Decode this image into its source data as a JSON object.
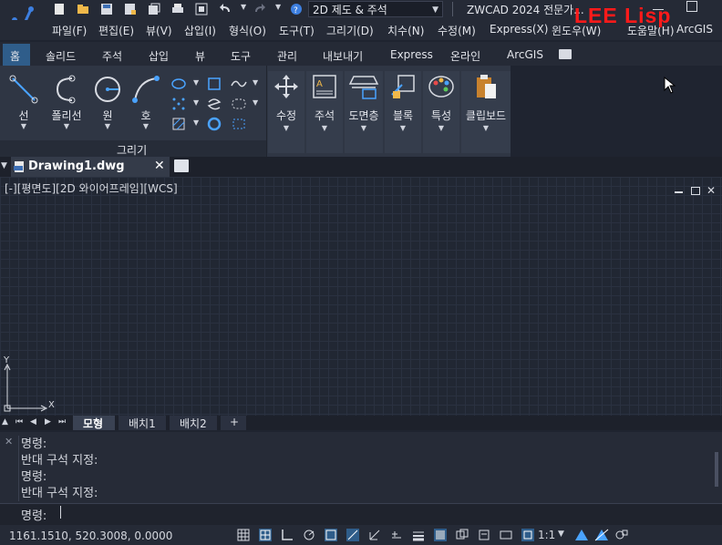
{
  "titlebar": {
    "workspace": "2D 제도 & 주석",
    "app_title": "ZWCAD 2024 전문가...",
    "watermark": "LEE Lisp"
  },
  "menubar": [
    "파일(F)",
    "편집(E)",
    "뷰(V)",
    "삽입(I)",
    "형식(O)",
    "도구(T)",
    "그리기(D)",
    "치수(N)",
    "수정(M)",
    "Express(X)",
    "윈도우(W)",
    "도움말(H)",
    "ArcGIS"
  ],
  "ribbon_tabs": [
    "홈",
    "솔리드",
    "주석",
    "삽입",
    "뷰",
    "도구",
    "관리",
    "내보내기",
    "Express",
    "온라인",
    "ArcGIS"
  ],
  "ribbon": {
    "draw_tools": [
      "선",
      "폴리선",
      "원",
      "호"
    ],
    "draw_panel_label": "그리기",
    "panels": [
      "수정",
      "주석",
      "도면층",
      "블록",
      "특성",
      "클립보드"
    ]
  },
  "doc_tab": {
    "name": "Drawing1.dwg"
  },
  "viewport": {
    "label": "[-][평면도][2D 와이어프레임][WCS]",
    "ucs_x": "X",
    "ucs_y": "Y"
  },
  "layout_tabs": [
    "모형",
    "배치1",
    "배치2",
    "+"
  ],
  "command": {
    "history": [
      "명령:",
      "반대 구석 지정:",
      "명령:",
      "반대 구석 지정:"
    ],
    "prompt": "명령:"
  },
  "status": {
    "coords": "1161.1510, 520.3008, 0.0000",
    "scale": "1:1"
  },
  "colors": {
    "accent": "#2f5d8a",
    "watermark": "#ff1a1a",
    "icon_blue": "#4aa3ff"
  }
}
